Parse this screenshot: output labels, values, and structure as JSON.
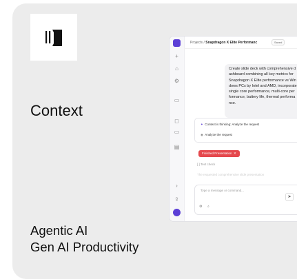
{
  "brand": {
    "name": "Context"
  },
  "tags": [
    "Agentic AI",
    "Gen AI Productivity"
  ],
  "screenshot": {
    "breadcrumb": {
      "root": "Projects",
      "separator": "/",
      "project": "Snapdragon X Elite Performanc"
    },
    "saved_badge": "Saved",
    "message_lines": [
      "Create slide deck with comprehensive d",
      "ashboard combining all key metrics for",
      "Snapdragon X Elite performance vs Win",
      "dows PCs by Intel and AMD, incorporate",
      "single core performance, multi-core per",
      "formance, battery life, thermal performa",
      "nce."
    ],
    "thinking": "Context is thinking: Analyze the request",
    "analyze": "Analyze the request",
    "finished_chip": "Finished Presentation",
    "text_check": "Text check",
    "faded_text": "The requested comprehensive slide presentation",
    "input_placeholder": "Type a message or command...",
    "colors": {
      "accent": "#5b3fd6",
      "chip": "#e5484d"
    }
  }
}
